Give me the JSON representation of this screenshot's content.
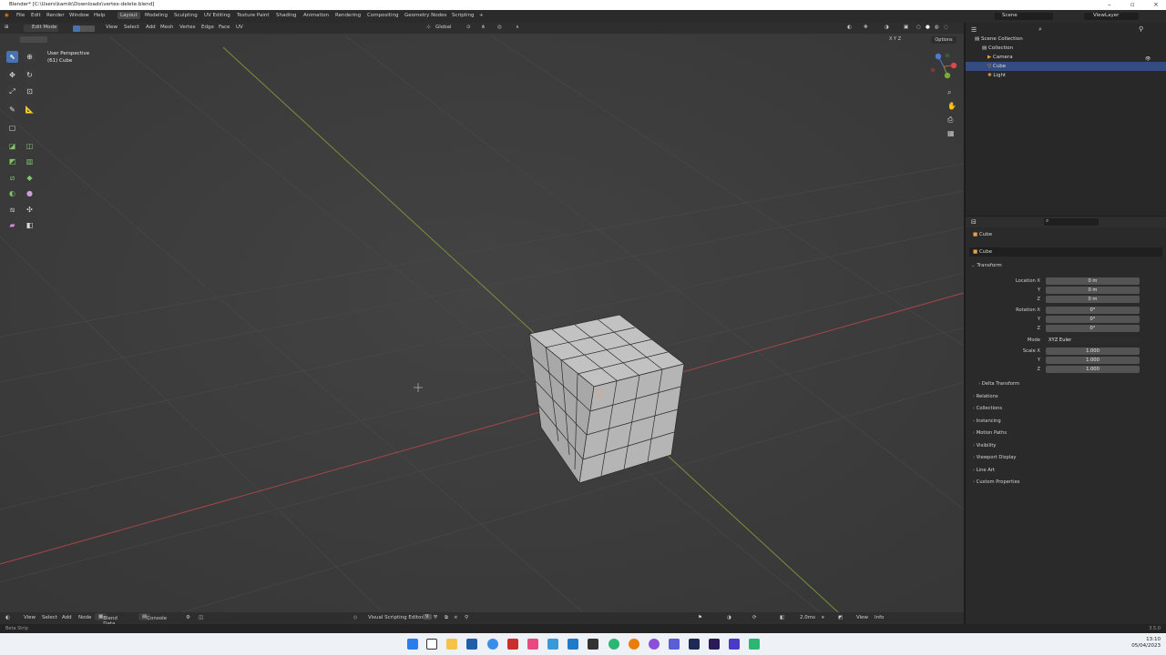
{
  "window": {
    "title": "Blender* [C:\\Users\\kamik\\Downloads\\vertex-delete.blend]"
  },
  "menubar": {
    "menus": [
      "File",
      "Edit",
      "Render",
      "Window",
      "Help"
    ],
    "workspaces": [
      "Layout",
      "Modeling",
      "Sculpting",
      "UV Editing",
      "Texture Paint",
      "Shading",
      "Animation",
      "Rendering",
      "Compositing",
      "Geometry Nodes",
      "Scripting"
    ],
    "add_tab": "+",
    "scene_label": "Scene",
    "view_layer_label": "ViewLayer"
  },
  "viewport_header": {
    "mode": "Edit Mode",
    "menus": [
      "View",
      "Select",
      "Add",
      "Mesh",
      "Vertex",
      "Edge",
      "Face",
      "UV"
    ],
    "orientation": "Global",
    "options": "Options",
    "axes": [
      "X",
      "Y",
      "Z"
    ]
  },
  "viewport": {
    "view_name": "User Perspective",
    "object_info": "(61) Cube"
  },
  "outliner": {
    "root": "Scene Collection",
    "collection": "Collection",
    "items": [
      "Camera",
      "Cube",
      "Light"
    ]
  },
  "properties": {
    "object_name": "Cube",
    "data_name": "Cube",
    "transform_title": "Transform",
    "location_label": "Location X",
    "rotation_label": "Rotation X",
    "scale_label": "Scale X",
    "mode_label": "Mode",
    "y_label": "Y",
    "z_label": "Z",
    "location": [
      "0 m",
      "0 m",
      "0 m"
    ],
    "rotation": [
      "0°",
      "0°",
      "0°"
    ],
    "rotation_mode": "XYZ Euler",
    "scale": [
      "1.000",
      "1.000",
      "1.000"
    ],
    "delta": "Delta Transform",
    "sections": [
      "Relations",
      "Collections",
      "Instancing",
      "Motion Paths",
      "Visibility",
      "Viewport Display",
      "Line Art",
      "Custom Properties"
    ]
  },
  "timeline": {
    "menus": [
      "View",
      "Select",
      "Add",
      "Node"
    ],
    "blend_data": "Blend Data",
    "console": "Console",
    "editor_name": "Visual Scripting Editor",
    "count": "9",
    "fps": "2.0ms",
    "view": "View",
    "info": "Info"
  },
  "statusbar": {
    "left": "Beta Strip",
    "version": "3.5.0"
  },
  "taskbar": {
    "time": "13:10",
    "date": "05/04/2023"
  },
  "colors": {
    "accent": "#4772b3",
    "selection": "#334d80",
    "x_axis": "#c04a4a",
    "y_axis": "#8aa43a"
  }
}
